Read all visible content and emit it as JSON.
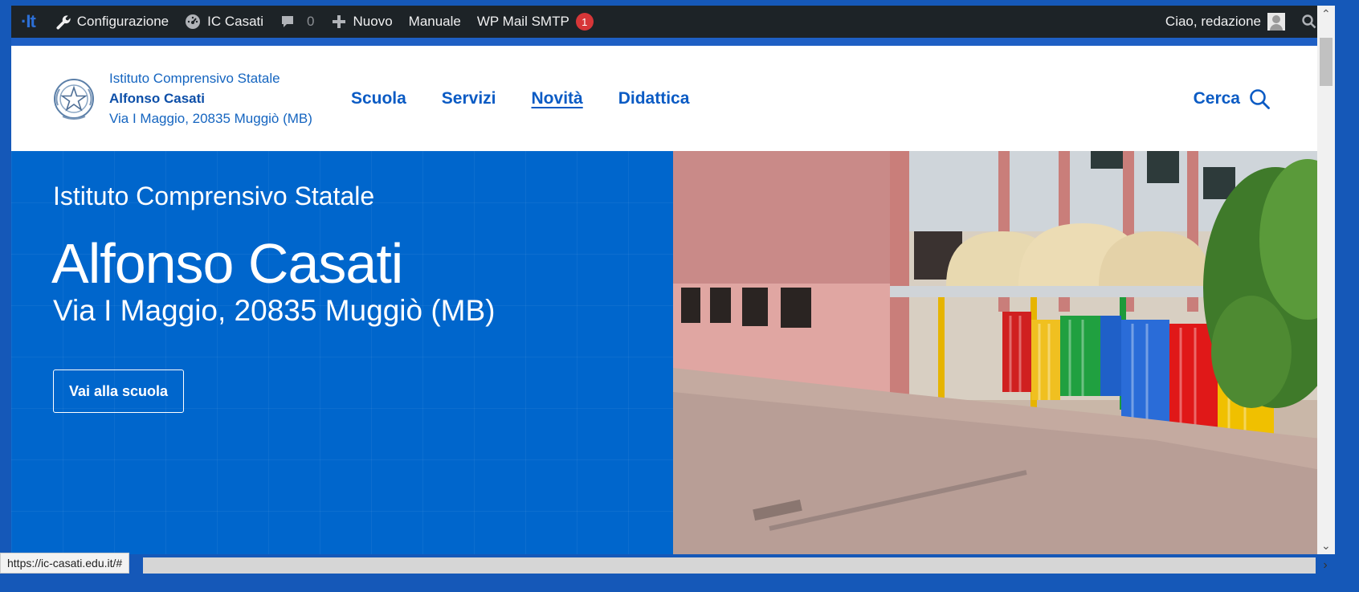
{
  "adminbar": {
    "logo": "·It",
    "items": [
      {
        "label": "Configurazione",
        "icon": "wrench-icon"
      },
      {
        "label": "IC Casati",
        "icon": "dashboard-icon"
      },
      {
        "label": "",
        "count": "0",
        "icon": "comment-icon"
      },
      {
        "label": "Nuovo",
        "icon": "plus-icon"
      },
      {
        "label": "Manuale"
      },
      {
        "label": "WP Mail SMTP",
        "badge": "1"
      }
    ],
    "greeting": "Ciao, redazione"
  },
  "header": {
    "brand": {
      "line1": "Istituto Comprensivo Statale",
      "line2": "Alfonso Casati",
      "line3": "Via I Maggio, 20835 Muggiò (MB)"
    },
    "nav": [
      {
        "label": "Scuola"
      },
      {
        "label": "Servizi"
      },
      {
        "label": "Novità",
        "active": true
      },
      {
        "label": "Didattica"
      }
    ],
    "search_label": "Cerca"
  },
  "hero": {
    "kicker": "Istituto Comprensivo Statale",
    "title": "Alfonso Casati",
    "subtitle": "Via I Maggio, 20835 Muggiò (MB)",
    "button_label": "Vai alla scuola"
  },
  "statusbar": {
    "url": "https://ic-casati.edu.it/#"
  },
  "colors": {
    "primary": "#0066cc",
    "adminbar": "#1d2327",
    "badge": "#d63638"
  }
}
